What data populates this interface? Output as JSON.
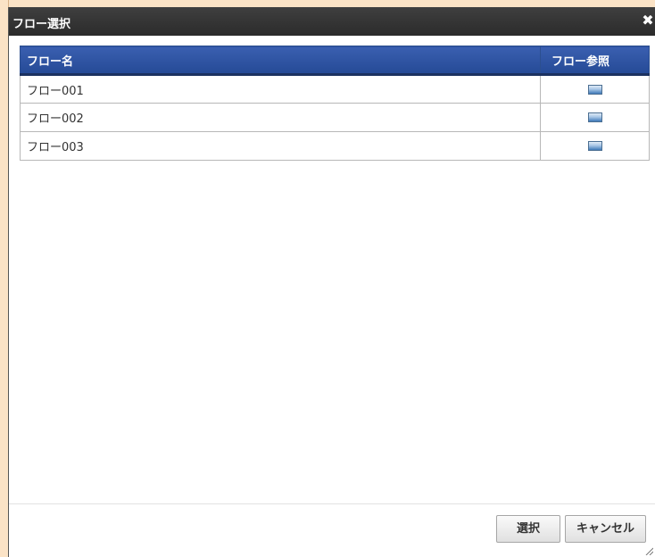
{
  "dialog": {
    "title": "フロー選択",
    "close_icon": "close-icon"
  },
  "table": {
    "headers": {
      "flow_name": "フロー名",
      "flow_ref": "フロー参照"
    },
    "rows": [
      {
        "name": "フロー001",
        "ref_icon": "image-icon"
      },
      {
        "name": "フロー002",
        "ref_icon": "image-icon"
      },
      {
        "name": "フロー003",
        "ref_icon": "image-icon"
      }
    ]
  },
  "footer": {
    "select_label": "選択",
    "cancel_label": "キャンセル"
  },
  "colors": {
    "titlebar": "#333333",
    "header": "#2e56a3",
    "background": "#fbe3c6"
  }
}
